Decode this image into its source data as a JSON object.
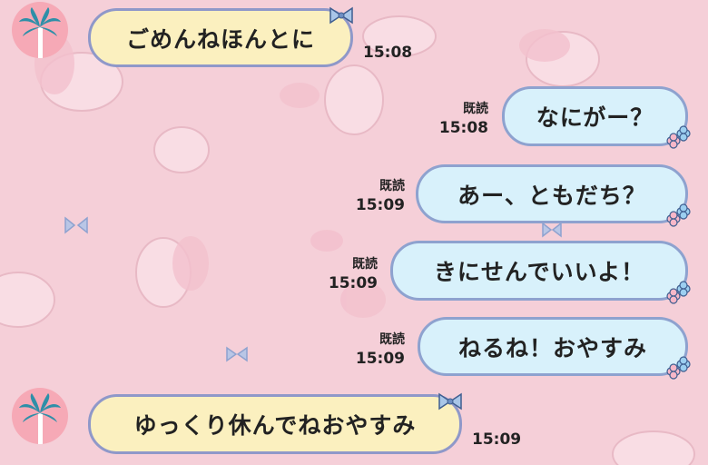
{
  "chat": {
    "messages": [
      {
        "side": "in",
        "text": "ごめんねほんとに",
        "time": "15:08"
      },
      {
        "side": "out",
        "text": "なにがー？",
        "read": "既読",
        "time": "15:08"
      },
      {
        "side": "out",
        "text": "あー、ともだち？",
        "read": "既読",
        "time": "15:09"
      },
      {
        "side": "out",
        "text": "きにせんでいいよ！",
        "read": "既読",
        "time": "15:09"
      },
      {
        "side": "out",
        "text": "ねるね！おやすみ",
        "read": "既読",
        "time": "15:09"
      },
      {
        "side": "in",
        "text": "ゆっくり休んでねおやすみ",
        "time": "15:09"
      }
    ]
  },
  "avatar_icon": "palm-tree-icon",
  "incoming_decoration_icon": "bow-ribbon-icon",
  "outgoing_decoration_icon": "flower-icon",
  "colors": {
    "background": "#f5cfd8",
    "incoming_bubble": "#fbf0bf",
    "outgoing_bubble": "#d8f1fb",
    "bubble_border": "#8f98c9",
    "avatar": "#f6a9b6"
  }
}
